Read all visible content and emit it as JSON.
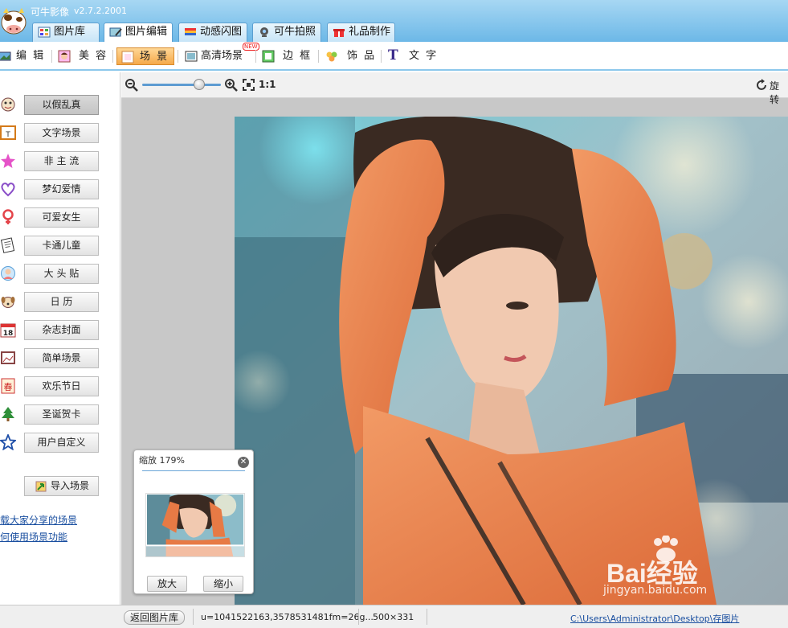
{
  "app": {
    "title": "可牛影像",
    "version": "v2.7.2.2001",
    "logo_icon": "cow-logo-icon"
  },
  "tabs": [
    {
      "label": "图片库",
      "icon": "gallery-icon",
      "active": false
    },
    {
      "label": "图片编辑",
      "icon": "edit-image-icon",
      "active": true
    },
    {
      "label": "动感闪图",
      "icon": "film-strip-icon",
      "active": false
    },
    {
      "label": "可牛拍照",
      "icon": "webcam-icon",
      "active": false
    },
    {
      "label": "礼品制作",
      "icon": "gift-icon",
      "active": false
    }
  ],
  "toolbar": [
    {
      "label": "编 辑",
      "icon": "photo-edit-icon"
    },
    {
      "label": "美 容",
      "icon": "beauty-face-icon"
    },
    {
      "label": "场 景",
      "icon": "scene-icon",
      "active": true
    },
    {
      "label": "高清场景",
      "icon": "hd-scene-icon",
      "badge": "NEW"
    },
    {
      "label": "边 框",
      "icon": "frame-icon"
    },
    {
      "label": "饰 品",
      "icon": "clover-icon"
    },
    {
      "label": "文 字",
      "icon": "text-t-icon"
    }
  ],
  "zoom_bar": {
    "actual_size": "1:1",
    "rotate_label": "旋转",
    "zoom_level": 0.72
  },
  "scene_categories": [
    {
      "label": "以假乱真",
      "icon": "mask-icon",
      "active": true
    },
    {
      "label": "文字场景",
      "icon": "text-scene-icon"
    },
    {
      "label": "非 主 流",
      "icon": "sparkle-star-icon"
    },
    {
      "label": "梦幻爱情",
      "icon": "heart-icon"
    },
    {
      "label": "可爱女生",
      "icon": "female-icon"
    },
    {
      "label": "卡通儿童",
      "icon": "notebook-icon"
    },
    {
      "label": "大 头 贴",
      "icon": "avatar-icon"
    },
    {
      "label": "日  历",
      "icon": "calendar-puppy-icon"
    },
    {
      "label": "杂志封面",
      "icon": "calendar-18-icon"
    },
    {
      "label": "简单场景",
      "icon": "simple-frame-icon"
    },
    {
      "label": "欢乐节日",
      "icon": "festival-icon"
    },
    {
      "label": "圣诞贺卡",
      "icon": "christmas-tree-icon"
    },
    {
      "label": "用户自定义",
      "icon": "star-outline-icon"
    }
  ],
  "import_scene": {
    "label": "导入场景",
    "icon": "import-arrow-icon"
  },
  "left_links": [
    {
      "label": "载大家分享的场景"
    },
    {
      "label": "何使用场景功能"
    }
  ],
  "zoom_panel": {
    "title": "缩放 179%",
    "zoom_in": "放大",
    "zoom_out": "缩小"
  },
  "status": {
    "back_button": "返回图片库",
    "file_name": "u=1041522163,3578531481fm=26g...",
    "dimensions": "500×331",
    "path": "C:\\Users\\Administrator\\Desktop\\存图片"
  },
  "watermark": {
    "brand": "Bai经验",
    "url": "jingyan.baidu.com"
  }
}
